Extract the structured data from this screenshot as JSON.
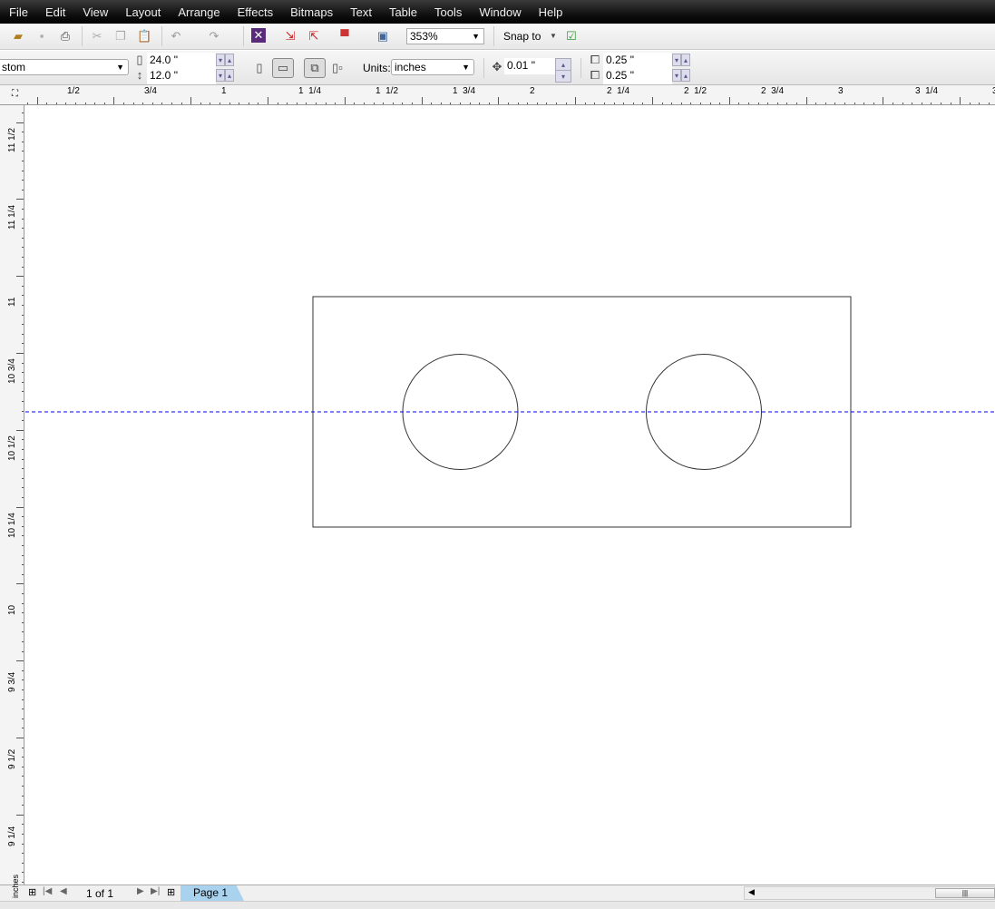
{
  "menu": [
    "File",
    "Edit",
    "View",
    "Layout",
    "Arrange",
    "Effects",
    "Bitmaps",
    "Text",
    "Table",
    "Tools",
    "Window",
    "Help"
  ],
  "toolbar": {
    "zoom_value": "353%",
    "snap_label": "Snap to"
  },
  "property_bar": {
    "page_size": "stom",
    "width": "24.0 \"",
    "height": "12.0 \"",
    "units_label": "Units:",
    "units_value": "inches",
    "nudge": "0.01 \"",
    "dup_x": "0.25 \"",
    "dup_y": "0.25 \""
  },
  "ruler": {
    "horizontal": [
      "1/2",
      "3/4",
      "1",
      "1  1/4",
      "1  1/2",
      "1  3/4",
      "2",
      "2  1/4",
      "2  1/2",
      "2  3/4",
      "3",
      "3  1/4",
      "3"
    ],
    "vertical": [
      "11 1/2",
      "11 1/4",
      "11",
      "10 3/4",
      "10 1/2",
      "10 1/4",
      "10",
      "9 3/4",
      "9 1/2",
      "9 1/4"
    ],
    "units": "inches"
  },
  "pager": {
    "count": "1 of 1",
    "tab": "Page 1"
  },
  "colors": {
    "guideline": "#0000ff",
    "page_tab": "#a9d2ee"
  }
}
